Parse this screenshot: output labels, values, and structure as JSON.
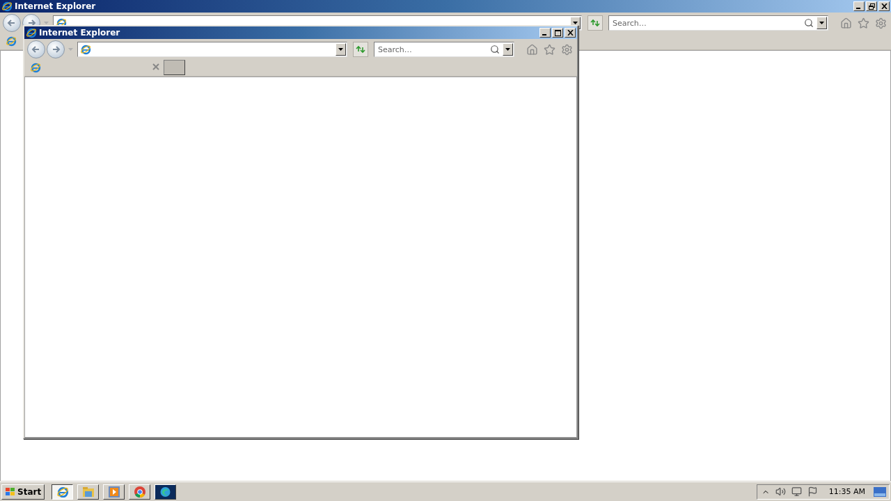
{
  "windows": [
    {
      "title": "Internet Explorer",
      "maximized": true,
      "search": {
        "placeholder": "Search…"
      }
    },
    {
      "title": "Internet Explorer",
      "maximized": false,
      "search": {
        "placeholder": "Search…"
      }
    }
  ],
  "taskbar": {
    "start": "Start",
    "apps": [
      {
        "kind": "ie",
        "selected": true
      },
      {
        "kind": "explorer",
        "selected": false
      },
      {
        "kind": "media",
        "selected": false
      },
      {
        "kind": "chrome",
        "selected": false
      },
      {
        "kind": "edge",
        "selected": false
      }
    ],
    "clock": "11:35 AM"
  }
}
